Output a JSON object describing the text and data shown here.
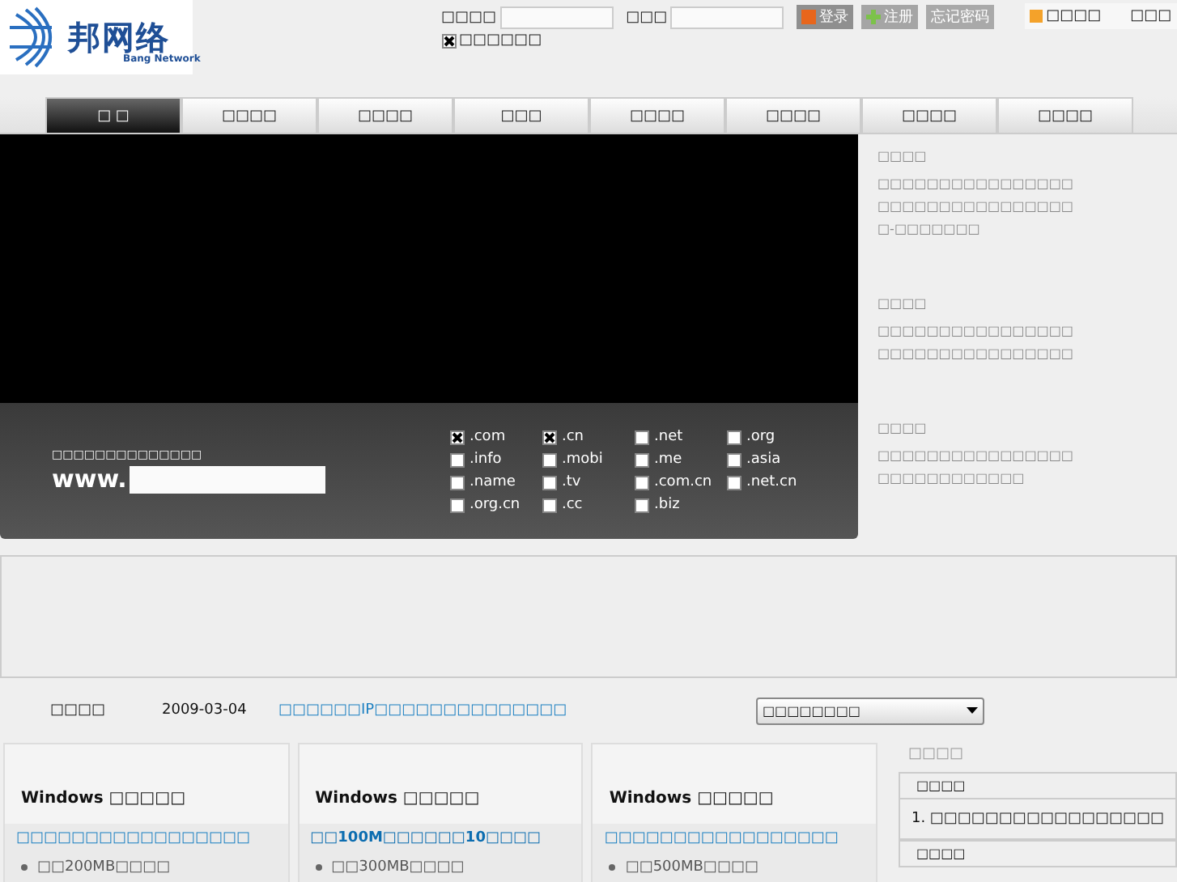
{
  "logo": {
    "name": "邦网络",
    "subtitle": "Bang Network"
  },
  "login": {
    "user_label": "□□□□",
    "password_label": "□□□",
    "buttons": [
      {
        "label": "登录",
        "kind": "login"
      },
      {
        "label": "注册",
        "kind": "register"
      },
      {
        "label": "忘记密码",
        "kind": "forgot"
      }
    ],
    "remember": {
      "label": "□□□□□□",
      "checked": true
    }
  },
  "top_links": [
    {
      "label": "□□□□",
      "kind": "icon"
    },
    {
      "label": "□□□",
      "kind": "plain"
    }
  ],
  "tabs": [
    {
      "label": "□ □",
      "selected": true
    },
    {
      "label": "□□□□",
      "selected": false
    },
    {
      "label": "□□□□",
      "selected": false
    },
    {
      "label": "□□□",
      "selected": false
    },
    {
      "label": "□□□□",
      "selected": false
    },
    {
      "label": "□□□□",
      "selected": false
    },
    {
      "label": "□□□□",
      "selected": false
    },
    {
      "label": "□□□□",
      "selected": false
    }
  ],
  "domain_search": {
    "label": "□□□□□□□□□□□□□□",
    "prefix": "www.",
    "extensions": [
      {
        "label": ".com",
        "checked": true
      },
      {
        "label": ".cn",
        "checked": true
      },
      {
        "label": ".net",
        "checked": false
      },
      {
        "label": ".org",
        "checked": false
      },
      {
        "label": ".info",
        "checked": false
      },
      {
        "label": ".mobi",
        "checked": false
      },
      {
        "label": ".me",
        "checked": false
      },
      {
        "label": ".asia",
        "checked": false
      },
      {
        "label": ".name",
        "checked": false
      },
      {
        "label": ".tv",
        "checked": false
      },
      {
        "label": ".com.cn",
        "checked": false
      },
      {
        "label": ".net.cn",
        "checked": false
      },
      {
        "label": ".org.cn",
        "checked": false
      },
      {
        "label": ".cc",
        "checked": false
      },
      {
        "label": ".biz",
        "checked": false
      }
    ]
  },
  "features": [
    {
      "title": "□□□□",
      "text": "□□□□□□□□□□□□□□□□□□□□□□□□□□□□□□□□□-□□□□□□□"
    },
    {
      "title": "□□□□",
      "text": "□□□□□□□□□□□□□□□□□□□□□□□□□□□□□□□□"
    },
    {
      "title": "□□□□",
      "text": "□□□□□□□□□□□□□□□□□□□□□□□□□□□□"
    }
  ],
  "news": {
    "label": "□□□□",
    "date": "2009-03-04",
    "headline": "□□□□□□IP□□□□□□□□□□□□□□"
  },
  "select": {
    "value": "□□□□□□□□"
  },
  "cards": [
    {
      "title": "Windows □□□□□",
      "link": "□□□□□□□□□□□□□□□□□",
      "bold": false,
      "bullet": "□□200MB□□□□"
    },
    {
      "title": "Windows □□□□□",
      "link": "□□100M□□□□□□10□□□□",
      "bold": true,
      "bullet": "□□300MB□□□□"
    },
    {
      "title": "Windows □□□□□",
      "link": "□□□□□□□□□□□□□□□□□",
      "bold": false,
      "bullet": "□□500MB□□□□"
    }
  ],
  "sidebar": {
    "title": "□□□□",
    "sections": [
      {
        "heading": "□□□□",
        "items": [
          "1. □□□□□□□□□□□□□□□□□"
        ]
      },
      {
        "heading": "□□□□"
      }
    ]
  }
}
